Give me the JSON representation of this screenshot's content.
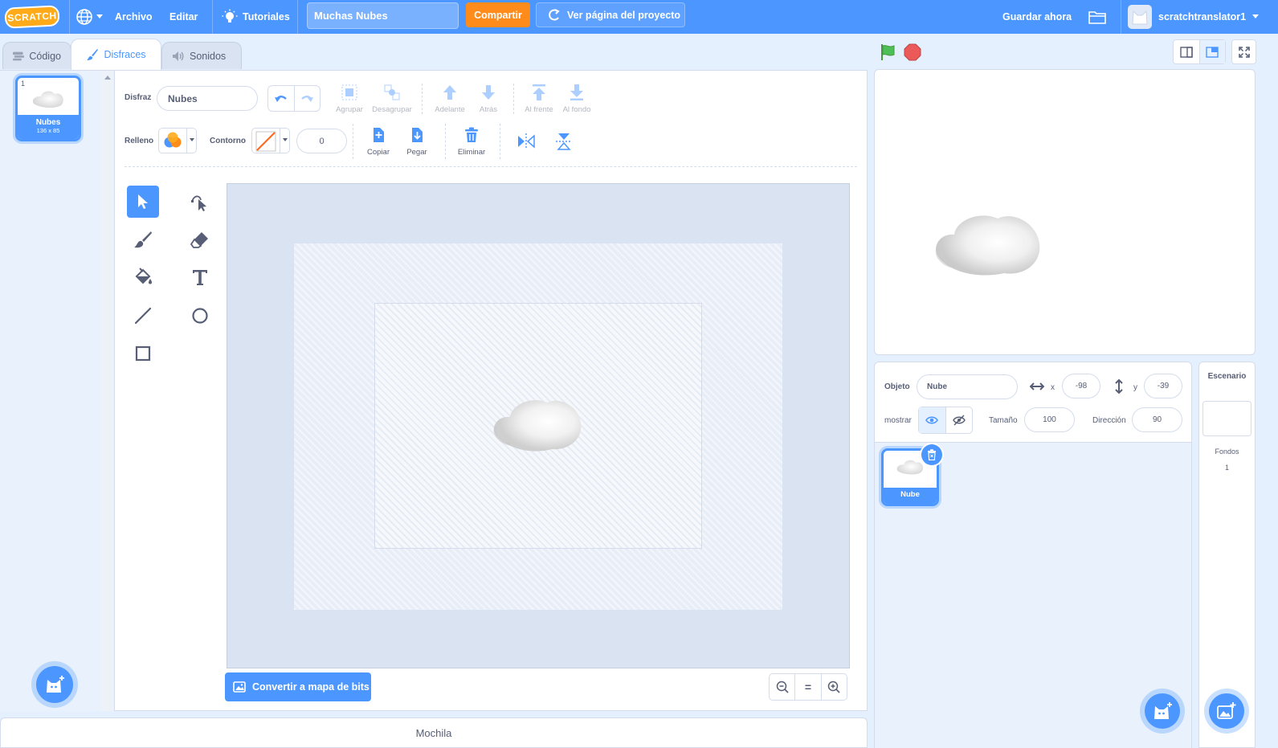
{
  "menubar": {
    "logo": "SCRATCH",
    "file": "Archivo",
    "edit": "Editar",
    "tutorials": "Tutoriales",
    "project_title": "Muchas Nubes",
    "share": "Compartir",
    "see_project": "Ver página del proyecto",
    "save_now": "Guardar ahora",
    "username": "scratchtranslator1"
  },
  "tabs": {
    "code": "Código",
    "costumes": "Disfraces",
    "sounds": "Sonidos"
  },
  "costume_list": {
    "items": [
      {
        "number": "1",
        "name": "Nubes",
        "size": "136 x 85"
      }
    ]
  },
  "paint": {
    "costume_label": "Disfraz",
    "costume_name": "Nubes",
    "group": "Agrupar",
    "ungroup": "Desagrupar",
    "forward": "Adelante",
    "backward": "Atrás",
    "front": "Al frente",
    "back": "Al fondo",
    "fill_label": "Relleno",
    "outline_label": "Contorno",
    "outline_width": "0",
    "copy": "Copiar",
    "paste": "Pegar",
    "delete": "Eliminar",
    "convert_bitmap": "Convertir a mapa de bits",
    "zoom_reset": "="
  },
  "backpack": "Mochila",
  "sprite_info": {
    "sprite_label": "Objeto",
    "sprite_name": "Nube",
    "x_label": "x",
    "x_value": "-98",
    "y_label": "y",
    "y_value": "-39",
    "show_label": "mostrar",
    "size_label": "Tamaño",
    "size_value": "100",
    "direction_label": "Dirección",
    "direction_value": "90"
  },
  "sprites": [
    {
      "name": "Nube"
    }
  ],
  "stage_panel": {
    "title": "Escenario",
    "backdrops_label": "Fondos",
    "backdrops_count": "1"
  },
  "colors": {
    "primary": "#4c97ff",
    "orange": "#ff8c1a",
    "green_flag": "#4cbf56",
    "stop": "#ec5959"
  }
}
